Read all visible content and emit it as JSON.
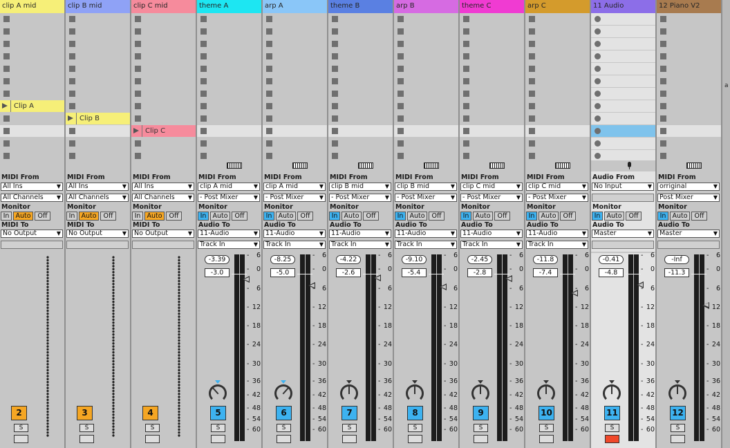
{
  "edge_label": "a",
  "selected_scene": 9,
  "colors": {
    "monitor_auto": "#f5a623",
    "monitor_in": "#3db2f0",
    "midi_track_number": "#f5a623",
    "audio_track_number": "#3db2f0",
    "record_armed": "#f0482a"
  },
  "scale_ticks": [
    "6",
    "0",
    "6",
    "12",
    "18",
    "24",
    "30",
    "36",
    "42",
    "48",
    "54",
    "60"
  ],
  "tracks": [
    {
      "name": "clip A mid",
      "color": "#f6ef78",
      "type": "midi",
      "number": "2",
      "clips": [
        {
          "row": 7,
          "name": "Clip A",
          "color": "#f6ef78"
        }
      ],
      "io": {
        "from_label": "MIDI From",
        "from": "All Ins",
        "from2": "All Channels",
        "monitor_label": "Monitor",
        "monitor": [
          "In",
          "Auto",
          "Off"
        ],
        "monitor_active": 1,
        "to_label": "MIDI To",
        "to": "No Output",
        "to2": ""
      },
      "mixer": {
        "solo": "S"
      }
    },
    {
      "name": "clip B mid",
      "color": "#8fa2f6",
      "type": "midi",
      "number": "3",
      "clips": [
        {
          "row": 8,
          "name": "Clip B",
          "color": "#f6ef78"
        }
      ],
      "io": {
        "from_label": "MIDI From",
        "from": "All Ins",
        "from2": "All Channels",
        "monitor_label": "Monitor",
        "monitor": [
          "In",
          "Auto",
          "Off"
        ],
        "monitor_active": 1,
        "to_label": "MIDI To",
        "to": "No Output",
        "to2": ""
      },
      "mixer": {
        "solo": "S"
      }
    },
    {
      "name": "clip C mid",
      "color": "#f68b9c",
      "type": "midi",
      "number": "4",
      "clips": [
        {
          "row": 9,
          "name": "Clip C",
          "color": "#f68b9c"
        }
      ],
      "io": {
        "from_label": "MIDI From",
        "from": "All Ins",
        "from2": "All Channels",
        "monitor_label": "Monitor",
        "monitor": [
          "In",
          "Auto",
          "Off"
        ],
        "monitor_active": 1,
        "to_label": "MIDI To",
        "to": "No Output",
        "to2": ""
      },
      "mixer": {
        "solo": "S"
      }
    },
    {
      "name": "theme A",
      "color": "#1de6f2",
      "type": "instrument",
      "number": "5",
      "clips": [],
      "io": {
        "from_label": "MIDI From",
        "from": "clip A mid",
        "from2": "- Post Mixer",
        "monitor_label": "Monitor",
        "monitor": [
          "In",
          "Auto",
          "Off"
        ],
        "monitor_active": 0,
        "to_label": "Audio To",
        "to": "11-Audio",
        "to2": "Track In"
      },
      "mixer": {
        "peak": "-3.39",
        "volume": "-3.0",
        "volume_db": -3.0,
        "pan": -0.35,
        "solo": "S"
      }
    },
    {
      "name": "arp A",
      "color": "#8ac6f8",
      "type": "instrument",
      "number": "6",
      "clips": [],
      "io": {
        "from_label": "MIDI From",
        "from": "clip A mid",
        "from2": "- Post Mixer",
        "monitor_label": "Monitor",
        "monitor": [
          "In",
          "Auto",
          "Off"
        ],
        "monitor_active": 0,
        "to_label": "Audio To",
        "to": "11-Audio",
        "to2": "Track In"
      },
      "mixer": {
        "peak": "-8.25",
        "volume": "-5.0",
        "volume_db": -5.0,
        "pan": 0.35,
        "solo": "S"
      }
    },
    {
      "name": "theme B",
      "color": "#5a80e2",
      "type": "instrument",
      "number": "7",
      "clips": [],
      "io": {
        "from_label": "MIDI From",
        "from": "clip B mid",
        "from2": "- Post Mixer",
        "monitor_label": "Monitor",
        "monitor": [
          "In",
          "Auto",
          "Off"
        ],
        "monitor_active": 0,
        "to_label": "Audio To",
        "to": "11-Audio",
        "to2": "Track In"
      },
      "mixer": {
        "peak": "-4.22",
        "volume": "-2.6",
        "volume_db": -2.6,
        "pan": 0,
        "solo": "S"
      }
    },
    {
      "name": "arp B",
      "color": "#d66be2",
      "type": "instrument",
      "number": "8",
      "clips": [],
      "io": {
        "from_label": "MIDI From",
        "from": "clip B mid",
        "from2": "- Post Mixer",
        "monitor_label": "Monitor",
        "monitor": [
          "In",
          "Auto",
          "Off"
        ],
        "monitor_active": 0,
        "to_label": "Audio To",
        "to": "11-Audio",
        "to2": "Track In"
      },
      "mixer": {
        "peak": "-9.10",
        "volume": "-5.4",
        "volume_db": -5.4,
        "pan": 0,
        "solo": "S"
      }
    },
    {
      "name": "theme C",
      "color": "#f03bd2",
      "type": "instrument",
      "number": "9",
      "clips": [],
      "io": {
        "from_label": "MIDI From",
        "from": "clip C mid",
        "from2": "- Post Mixer",
        "monitor_label": "Monitor",
        "monitor": [
          "In",
          "Auto",
          "Off"
        ],
        "monitor_active": 0,
        "to_label": "Audio To",
        "to": "11-Audio",
        "to2": "Track In"
      },
      "mixer": {
        "peak": "-2.45",
        "volume": "-2.8",
        "volume_db": -2.8,
        "pan": 0,
        "solo": "S"
      }
    },
    {
      "name": "arp C",
      "color": "#d49b2c",
      "type": "instrument",
      "number": "10",
      "clips": [],
      "io": {
        "from_label": "MIDI From",
        "from": "clip C mid",
        "from2": "- Post Mixer",
        "monitor_label": "Monitor",
        "monitor": [
          "In",
          "Auto",
          "Off"
        ],
        "monitor_active": 0,
        "to_label": "Audio To",
        "to": "11-Audio",
        "to2": "Track In"
      },
      "mixer": {
        "peak": "-11.8",
        "volume": "-7.4",
        "volume_db": -7.4,
        "pan": 0,
        "solo": "S"
      }
    },
    {
      "name": "11 Audio",
      "color": "#8c6ee8",
      "type": "audio",
      "number": "11",
      "clips": [],
      "io": {
        "from_label": "Audio From",
        "from": "No Input",
        "from2": "",
        "monitor_label": "Monitor",
        "monitor": [
          "In",
          "Auto",
          "Off"
        ],
        "monitor_active": 0,
        "to_label": "Audio To",
        "to": "Master",
        "to2": ""
      },
      "mixer": {
        "peak": "-0.41",
        "volume": "-4.8",
        "volume_db": -4.8,
        "pan": 0,
        "solo": "S",
        "armed": true
      }
    },
    {
      "name": "12 Piano V2",
      "color": "#a87b4f",
      "type": "instrument",
      "number": "12",
      "clips": [],
      "io": {
        "from_label": "MIDI From",
        "from": "orriginal",
        "from2": "Post Mixer",
        "monitor_label": "Monitor",
        "monitor": [
          "In",
          "Auto",
          "Off"
        ],
        "monitor_active": 0,
        "to_label": "Audio To",
        "to": "Master",
        "to2": ""
      },
      "mixer": {
        "peak": "-Inf",
        "volume": "-11.3",
        "volume_db": -11.3,
        "pan": 0,
        "solo": "S"
      }
    }
  ]
}
